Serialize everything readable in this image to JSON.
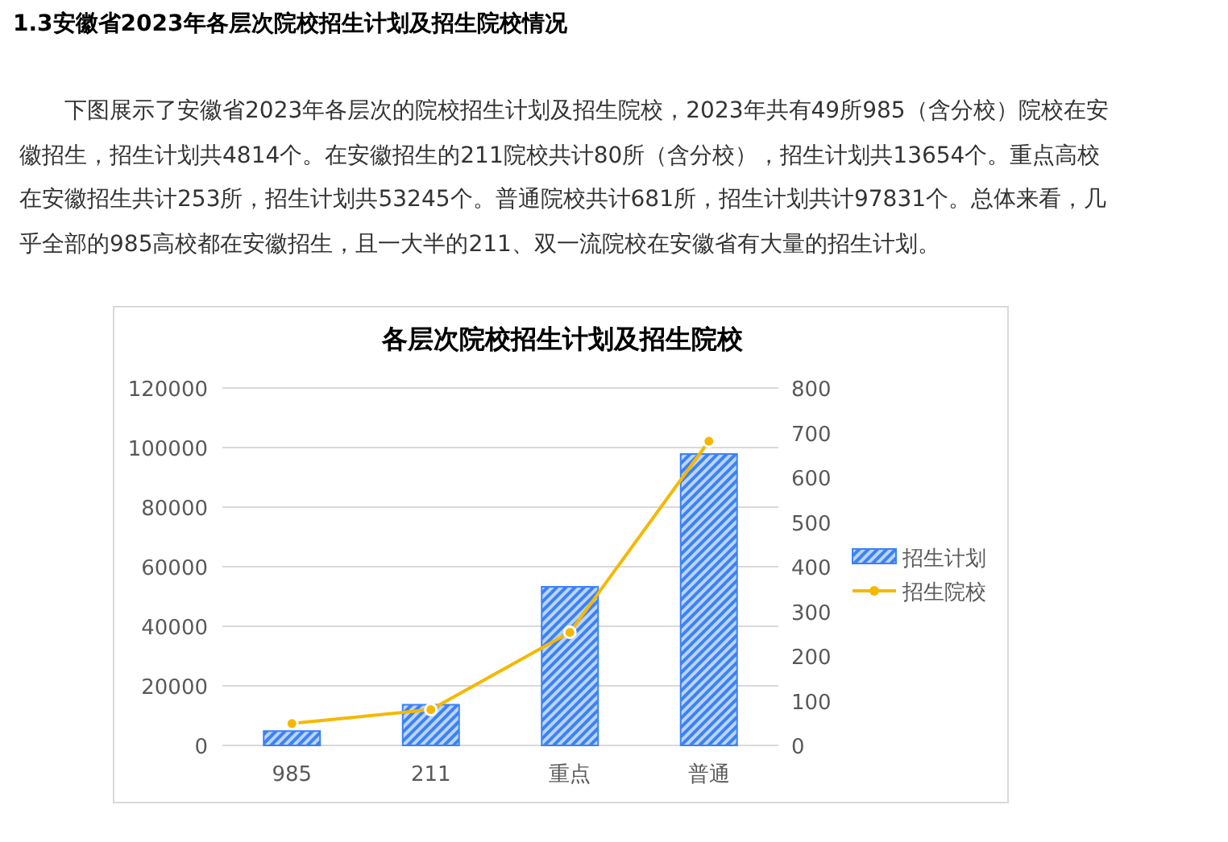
{
  "heading": "1.3安徽省2023年各层次院校招生计划及招生院校情况",
  "paragraph": "下图展示了安徽省2023年各层次的院校招生计划及招生院校，2023年共有49所985（含分校）院校在安徽招生，招生计划共4814个。在安徽招生的211院校共计80所（含分校），招生计划共13654个。重点高校在安徽招生共计253所，招生计划共53245个。普通院校共计681所，招生计划共计97831个。总体来看，几乎全部的985高校都在安徽招生，且一大半的211、双一流院校在安徽省有大量的招生计划。",
  "chart": {
    "chart_data": {
      "type": "bar",
      "title": "各层次院校招生计划及招生院校",
      "categories": [
        "985",
        "211",
        "重点",
        "普通"
      ],
      "series": [
        {
          "name": "招生计划",
          "color": "#3b82f6",
          "values": [
            4814,
            13654,
            53245,
            97831
          ]
        },
        {
          "name": "招生院校",
          "type": "line",
          "axis": "y2",
          "marker": "circle",
          "color": "#f5b800",
          "values": [
            49,
            80,
            253,
            681
          ]
        }
      ],
      "ylim": [
        0,
        120000
      ],
      "yticks": [
        0,
        20000,
        40000,
        60000,
        80000,
        100000,
        120000
      ],
      "grid": true,
      "legend": "right",
      "y2lim": [
        0,
        800
      ],
      "y2ticks": [
        0,
        100,
        200,
        300,
        400,
        500,
        600,
        700,
        800
      ]
    }
  }
}
